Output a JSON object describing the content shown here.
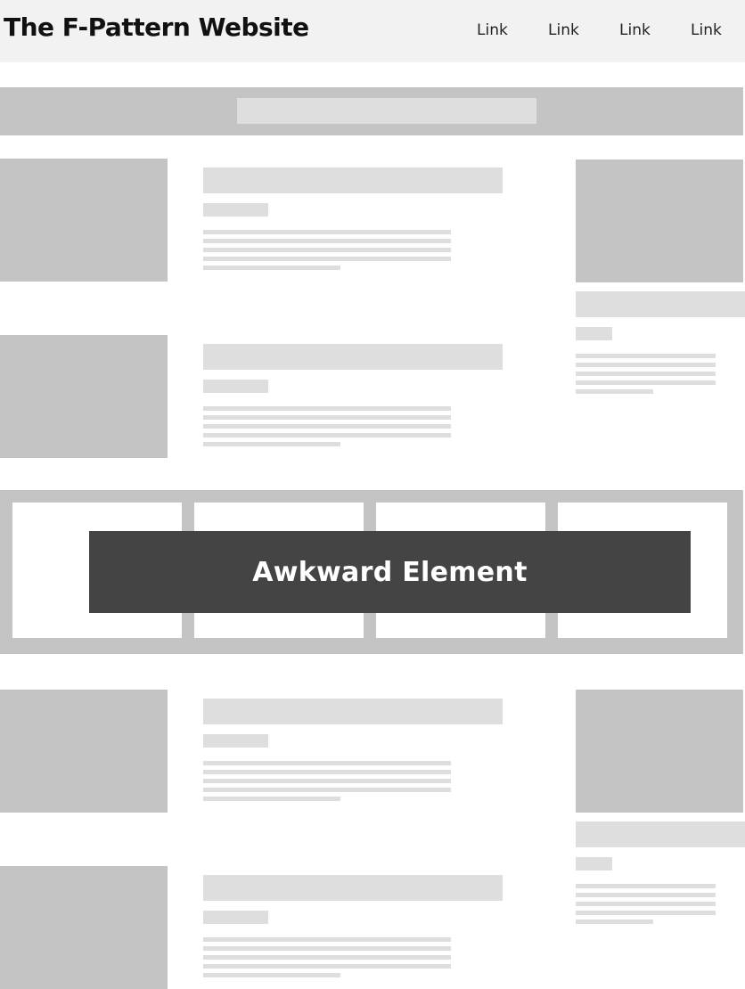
{
  "header": {
    "title": "The F-Pattern Website",
    "links": [
      "Link",
      "Link",
      "Link",
      "Link"
    ]
  },
  "awkward": {
    "label": "Awkward Element"
  }
}
